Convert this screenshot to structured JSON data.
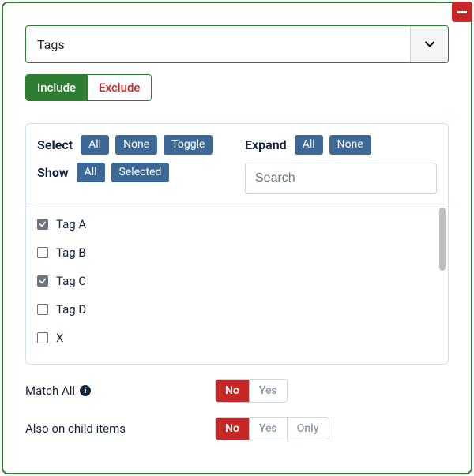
{
  "dropdown": {
    "label": "Tags"
  },
  "mode_toggle": {
    "include": "Include",
    "exclude": "Exclude",
    "active": "include"
  },
  "selector": {
    "select_label": "Select",
    "select_actions": {
      "all": "All",
      "none": "None",
      "toggle": "Toggle"
    },
    "show_label": "Show",
    "show_actions": {
      "all": "All",
      "selected": "Selected"
    },
    "expand_label": "Expand",
    "expand_actions": {
      "all": "All",
      "none": "None"
    },
    "search_placeholder": "Search"
  },
  "items": [
    {
      "label": "Tag A",
      "checked": true
    },
    {
      "label": "Tag B",
      "checked": false
    },
    {
      "label": "Tag C",
      "checked": true
    },
    {
      "label": "Tag D",
      "checked": false
    },
    {
      "label": "X",
      "checked": false
    }
  ],
  "match_all": {
    "label": "Match All",
    "options": {
      "no": "No",
      "yes": "Yes"
    },
    "active": "no"
  },
  "child_items": {
    "label": "Also on child items",
    "options": {
      "no": "No",
      "yes": "Yes",
      "only": "Only"
    },
    "active": "no"
  }
}
